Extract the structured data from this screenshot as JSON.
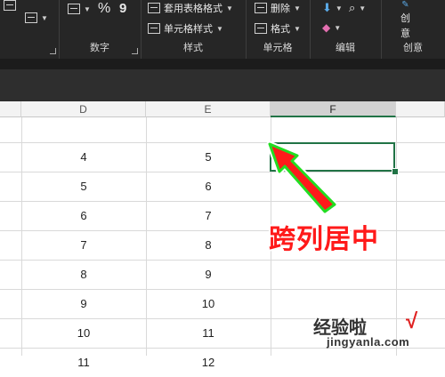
{
  "ribbon": {
    "number_group": {
      "label": "数字",
      "percent_symbol": "%",
      "comma_symbol": "9"
    },
    "styles_group": {
      "label": "样式",
      "table_format": "套用表格格式",
      "cell_styles": "单元格样式"
    },
    "cells_group": {
      "label": "单元格",
      "delete": "删除",
      "format": "格式"
    },
    "editing_group": {
      "label": "编辑"
    },
    "ideas_group": {
      "label": "创意",
      "button_line1": "创",
      "button_line2": "意"
    }
  },
  "columns": [
    "D",
    "E",
    "F"
  ],
  "selected_column": "F",
  "rows": [
    {
      "d": "",
      "e": ""
    },
    {
      "d": "4",
      "e": "5"
    },
    {
      "d": "5",
      "e": "6"
    },
    {
      "d": "6",
      "e": "7"
    },
    {
      "d": "7",
      "e": "8"
    },
    {
      "d": "8",
      "e": "9"
    },
    {
      "d": "9",
      "e": "10"
    },
    {
      "d": "10",
      "e": "11"
    },
    {
      "d": "11",
      "e": "12"
    }
  ],
  "annotation": {
    "text": "跨列居中"
  },
  "watermark": {
    "title": "经验啦",
    "check": "√",
    "url": "jingyanla.com"
  },
  "colors": {
    "accent_green": "#217346",
    "annotation_red": "#ff1a1a",
    "arrow_green": "#22dd22"
  }
}
